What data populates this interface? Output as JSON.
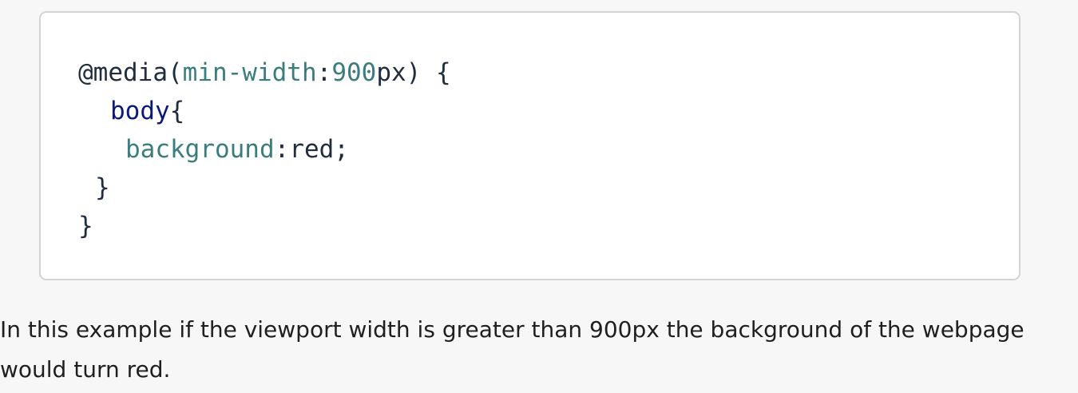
{
  "colors": {
    "page_background": "#f7f7f7",
    "code_background": "#ffffff",
    "code_border": "#d4d4d4",
    "property": "#3a7d7c",
    "selector": "#0a1a7a",
    "text": "#1f2d3d"
  },
  "code": {
    "line1": {
      "at_rule": "@media(",
      "feature": "min-width",
      "colon": ":",
      "number": "900",
      "unit_close": "px) {"
    },
    "line2": {
      "selector": "body",
      "brace": "{"
    },
    "line3": {
      "property": "background",
      "colon": ":",
      "value": "red;"
    },
    "line4": {
      "brace": "}"
    },
    "line5": {
      "brace": "}"
    }
  },
  "description": "In this example if the viewport width is greater than 900px the background of the webpage would turn red."
}
